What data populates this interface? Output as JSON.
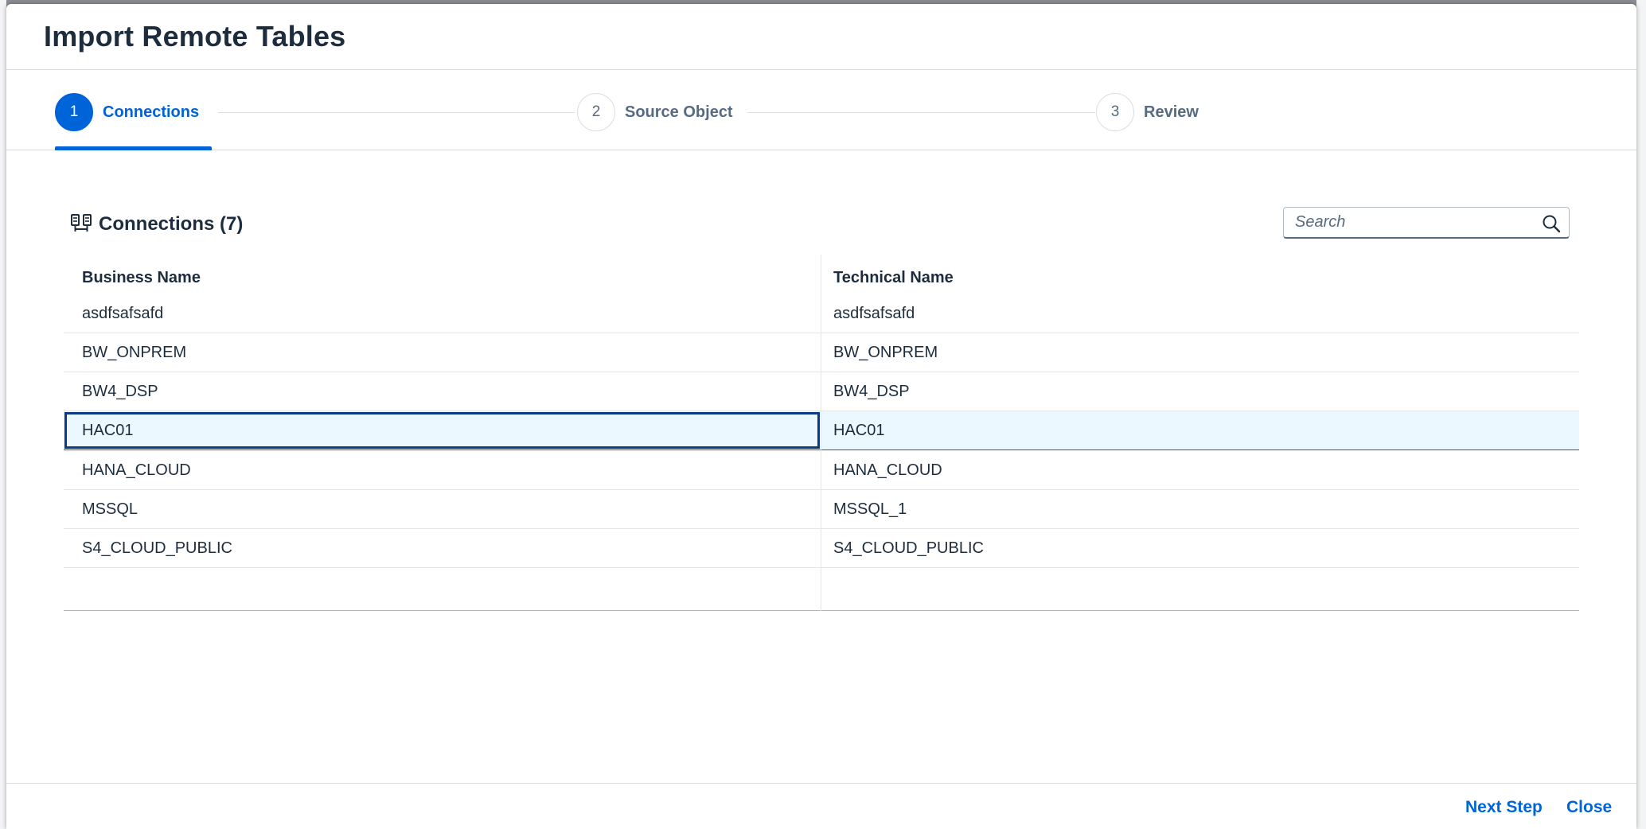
{
  "dialog": {
    "title": "Import Remote Tables"
  },
  "wizard": {
    "steps": [
      {
        "number": "1",
        "label": "Connections"
      },
      {
        "number": "2",
        "label": "Source Object"
      },
      {
        "number": "3",
        "label": "Review"
      }
    ],
    "active_step": 1
  },
  "table": {
    "title": "Connections (7)",
    "icon": "connections-icon",
    "search_placeholder": "Search",
    "columns": [
      "Business Name",
      "Technical Name"
    ],
    "rows": [
      {
        "business": "asdfsafsafd",
        "technical": "asdfsafsafd"
      },
      {
        "business": "BW_ONPREM",
        "technical": "BW_ONPREM"
      },
      {
        "business": "BW4_DSP",
        "technical": "BW4_DSP"
      },
      {
        "business": "HAC01",
        "technical": "HAC01"
      },
      {
        "business": "HANA_CLOUD",
        "technical": "HANA_CLOUD"
      },
      {
        "business": "MSSQL",
        "technical": "MSSQL_1"
      },
      {
        "business": "S4_CLOUD_PUBLIC",
        "technical": "S4_CLOUD_PUBLIC"
      }
    ],
    "selected_row": "HAC01"
  },
  "footer": {
    "next_label": "Next Step",
    "close_label": "Close"
  },
  "colors": {
    "accent": "#0064d9",
    "text": "#1d2d3e",
    "selection": "#ebf8ff",
    "focus": "#0b3b86"
  }
}
